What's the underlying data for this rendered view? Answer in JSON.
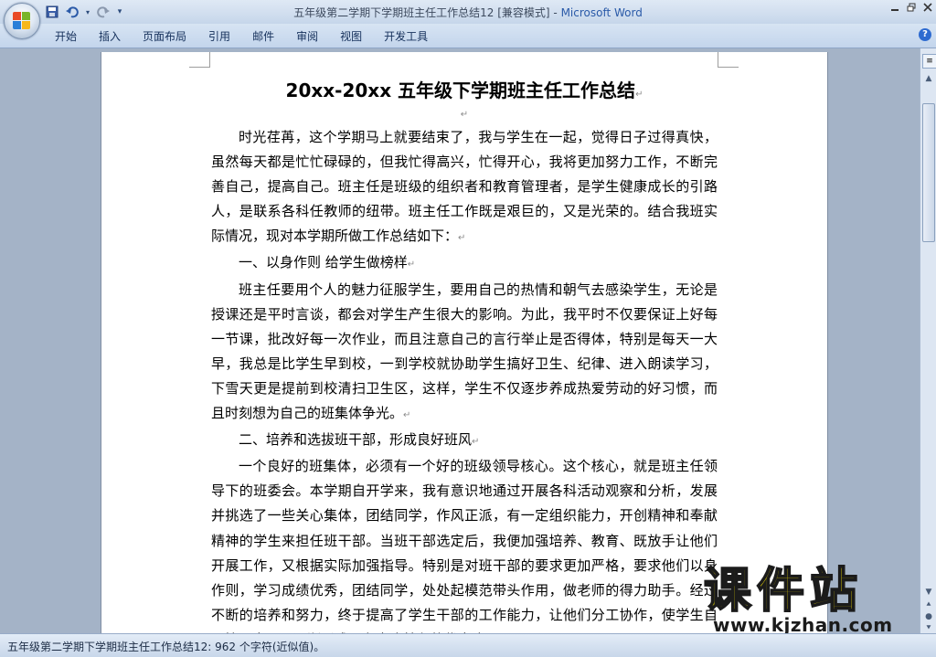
{
  "window": {
    "title_doc": "五年级第二学期下学期班主任工作总结12 [兼容模式] - ",
    "title_app": "Microsoft Word"
  },
  "ribbon": {
    "tabs": [
      "开始",
      "插入",
      "页面布局",
      "引用",
      "邮件",
      "审阅",
      "视图",
      "开发工具"
    ]
  },
  "document": {
    "title": "20xx-20xx 五年级下学期班主任工作总结",
    "paragraphs": [
      {
        "type": "para",
        "text": "时光荏苒，这个学期马上就要结束了，我与学生在一起，觉得日子过得真快，虽然每天都是忙忙碌碌的，但我忙得高兴，忙得开心，我将更加努力工作，不断完善自己，提高自己。班主任是班级的组织者和教育管理者，是学生健康成长的引路人，是联系各科任教师的纽带。班主任工作既是艰巨的，又是光荣的。结合我班实际情况，现对本学期所做工作总结如下："
      },
      {
        "type": "heading",
        "text": "一、以身作则 给学生做榜样"
      },
      {
        "type": "para",
        "text": "班主任要用个人的魅力征服学生，要用自己的热情和朝气去感染学生，无论是授课还是平时言谈，都会对学生产生很大的影响。为此，我平时不仅要保证上好每一节课，批改好每一次作业，而且注意自己的言行举止是否得体，特别是每天一大早，我总是比学生早到校，一到学校就协助学生搞好卫生、纪律、进入朗读学习，下雪天更是提前到校清扫卫生区，这样，学生不仅逐步养成热爱劳动的好习惯，而且时刻想为自己的班集体争光。"
      },
      {
        "type": "heading",
        "text": "二、培养和选拔班干部，形成良好班风"
      },
      {
        "type": "para",
        "text": "一个良好的班集体，必须有一个好的班级领导核心。这个核心，就是班主任领导下的班委会。本学期自开学来，我有意识地通过开展各科活动观察和分析，发展并挑选了一些关心集体，团结同学，作风正派，有一定组织能力，开创精神和奉献精神的学生来担任班干部。当班干部选定后，我便加强培养、教育、既放手让他们开展工作，又根据实际加强指导。特别是对班干部的要求更加严格，要求他们以身作则，学习成绩优秀，团结同学，处处起模范带头作用，做老师的得力助手。经过不断的培养和努力，终于提高了学生干部的工作能力，让他们分工协作，使学生自己管理自己，逐渐形成具有本班特色的优良班风。"
      }
    ]
  },
  "statusbar": {
    "text": "五年级第二学期下学期班主任工作总结12: 962 个字符(近似值)。"
  },
  "watermark": {
    "logo": "课件站",
    "url": "www.kjzhan.com"
  }
}
